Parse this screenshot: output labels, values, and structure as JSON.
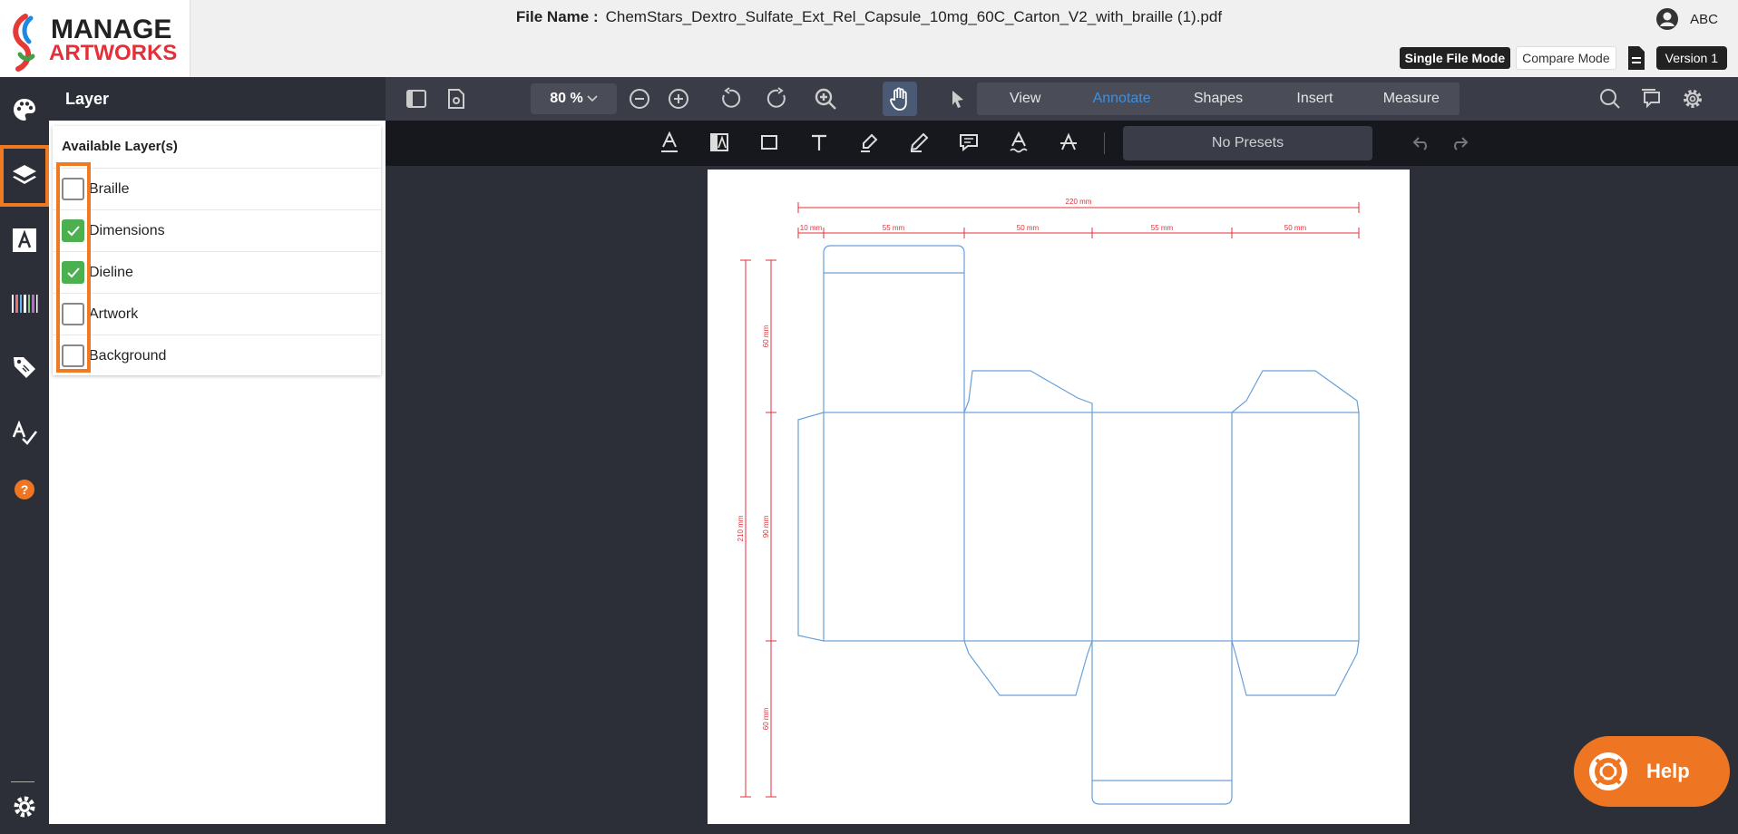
{
  "logo": {
    "line1": "MANAGE",
    "line2": "ARTWORKS"
  },
  "header": {
    "file_label": "File Name :",
    "file_name": "ChemStars_Dextro_Sulfate_Ext_Rel_Capsule_10mg_60C_Carton_V2_with_braille (1).pdf",
    "user": "ABC",
    "modes": {
      "single": "Single File Mode",
      "compare": "Compare Mode"
    },
    "version": "Version 1"
  },
  "rail": {
    "icons": [
      "palette-icon",
      "layers-icon",
      "text-icon",
      "barcode-icon",
      "tag-icon",
      "spellcheck-icon",
      "help-circle-icon",
      "settings-icon"
    ]
  },
  "panel": {
    "title": "Layer",
    "section": "Available Layer(s)",
    "layers": [
      {
        "label": "Braille",
        "checked": false
      },
      {
        "label": "Dimensions",
        "checked": true
      },
      {
        "label": "Dieline",
        "checked": true
      },
      {
        "label": "Artwork",
        "checked": false
      },
      {
        "label": "Background",
        "checked": false
      }
    ]
  },
  "toolbar": {
    "zoom": "80 %",
    "tabs": [
      "View",
      "Annotate",
      "Shapes",
      "Insert",
      "Measure"
    ],
    "active_tab": "Annotate",
    "presets": "No Presets"
  },
  "drawing": {
    "dims": [
      "220 mm",
      "10 mm",
      "55 mm",
      "50 mm",
      "55 mm",
      "50 mm"
    ],
    "vdims": [
      "60 mm",
      "210 mm",
      "90 mm",
      "60 mm"
    ]
  },
  "help": {
    "label": "Help"
  },
  "colors": {
    "accent": "#f07a22",
    "check": "#4caf50",
    "active_tab": "#3b8fe6",
    "dim_red": "#e5303a",
    "dieline_blue": "#6a9fd8"
  }
}
